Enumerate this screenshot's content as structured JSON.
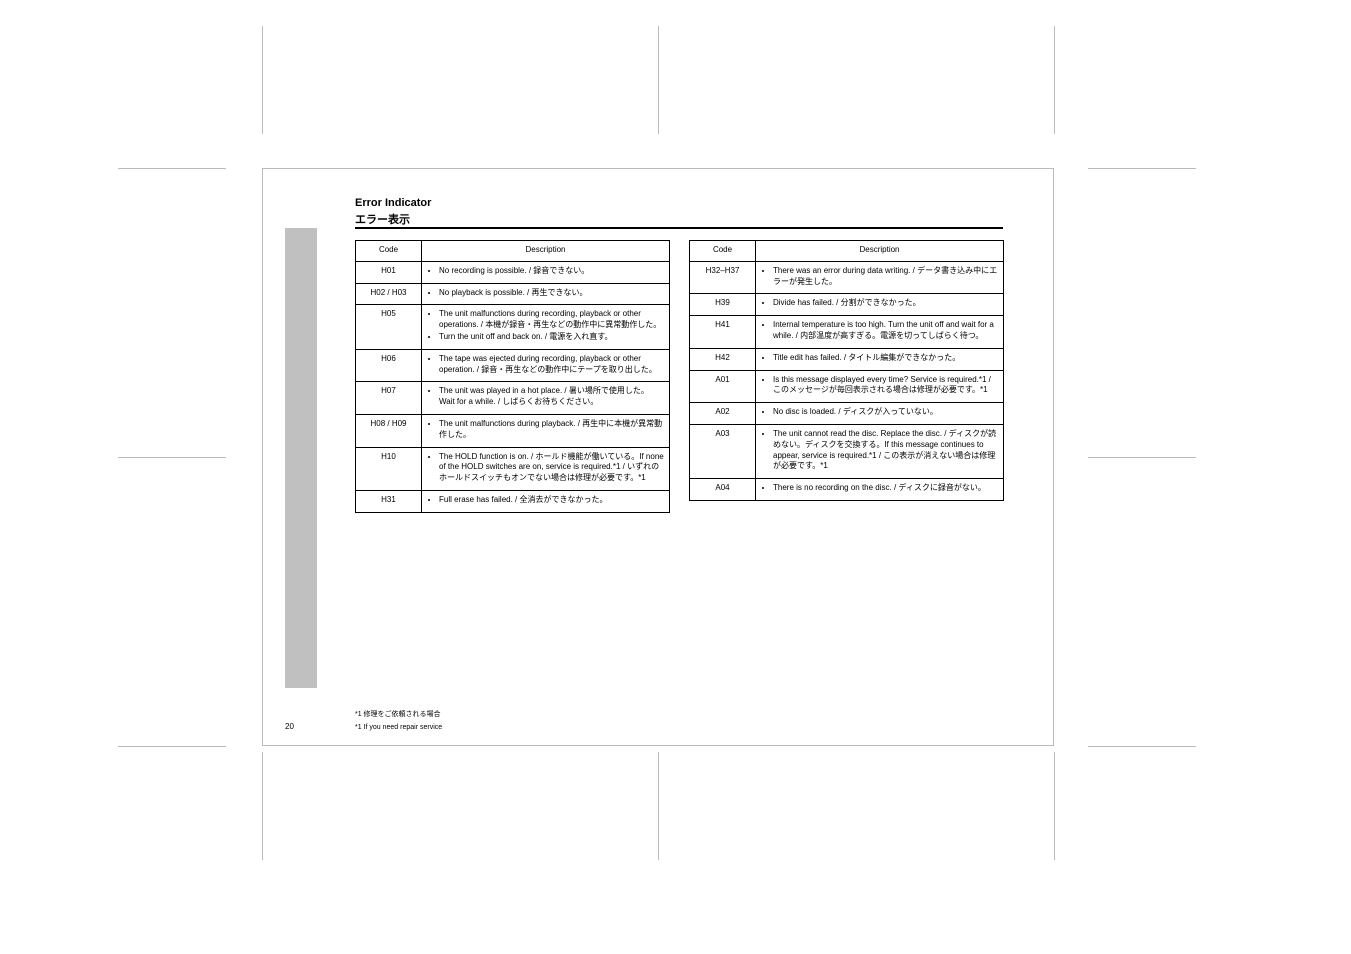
{
  "title_line1": "Error Indicator",
  "title_line2": "エラー表示",
  "page_number": "20",
  "footnote_jp": "*1 修理をご依頼される場合",
  "footnote_en": "*1 If you need repair service",
  "headers": {
    "code": "Code",
    "desc": "Description"
  },
  "left_rows": [
    {
      "code": "H01",
      "bullets": [
        "No recording is possible. / 録音できない。"
      ]
    },
    {
      "code": "H02 / H03",
      "bullets": [
        "No playback is possible. / 再生できない。"
      ]
    },
    {
      "code": "H05",
      "bullets": [
        "The unit malfunctions during recording, playback or other operations. / 本機が録音・再生などの動作中に異常動作した。",
        "Turn the unit off and back on. / 電源を入れ直す。"
      ]
    },
    {
      "code": "H06",
      "bullets": [
        "The tape was ejected during recording, playback or other operation. / 録音・再生などの動作中にテープを取り出した。"
      ]
    },
    {
      "code": "H07",
      "bullets": [
        "The unit was played in a hot place. / 暑い場所で使用した。Wait for a while. / しばらくお待ちください。"
      ]
    },
    {
      "code": "H08 / H09",
      "bullets": [
        "The unit malfunctions during playback. / 再生中に本機が異常動作した。"
      ]
    },
    {
      "code": "H10",
      "bullets": [
        "The HOLD function is on. / ホールド機能が働いている。If none of the HOLD switches are on, service is required.*1 / いずれのホールドスイッチもオンでない場合は修理が必要です。*1"
      ]
    },
    {
      "code": "H31",
      "bullets": [
        "Full erase has failed. / 全消去ができなかった。"
      ]
    }
  ],
  "right_rows": [
    {
      "code": "H32–H37",
      "bullets": [
        "There was an error during data writing. / データ書き込み中にエラーが発生した。"
      ]
    },
    {
      "code": "H39",
      "bullets": [
        "Divide has failed. / 分割ができなかった。"
      ]
    },
    {
      "code": "H41",
      "bullets": [
        "Internal temperature is too high. Turn the unit off and wait for a while. / 内部温度が高すぎる。電源を切ってしばらく待つ。"
      ]
    },
    {
      "code": "H42",
      "bullets": [
        "Title edit has failed. / タイトル編集ができなかった。"
      ]
    },
    {
      "code": "A01",
      "bullets": [
        "Is this message displayed every time? Service is required.*1 / このメッセージが毎回表示される場合は修理が必要です。*1"
      ]
    },
    {
      "code": "A02",
      "bullets": [
        "No disc is loaded. / ディスクが入っていない。"
      ]
    },
    {
      "code": "A03",
      "bullets": [
        "The unit cannot read the disc. Replace the disc. / ディスクが読めない。ディスクを交換する。If this message continues to appear, service is required.*1 / この表示が消えない場合は修理が必要です。*1"
      ]
    },
    {
      "code": "A04",
      "bullets": [
        "There is no recording on the disc. / ディスクに録音がない。"
      ]
    }
  ]
}
